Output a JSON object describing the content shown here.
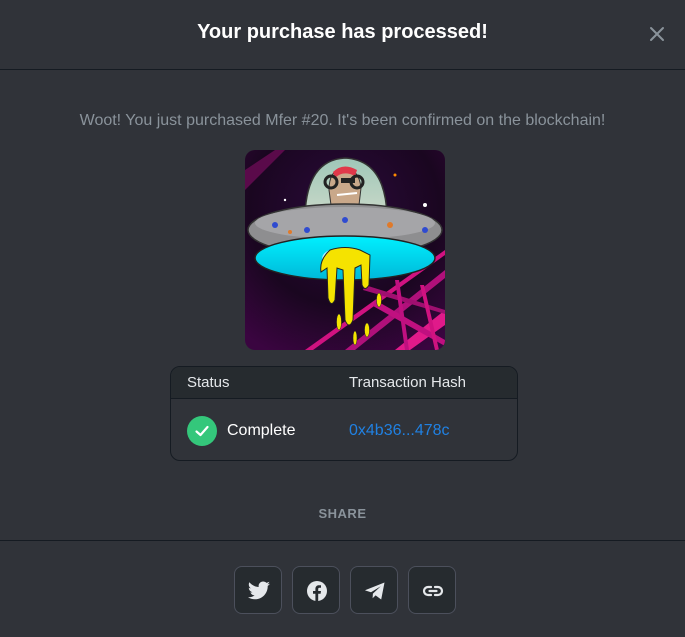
{
  "modal": {
    "title": "Your purchase has processed!",
    "message": "Woot! You just purchased Mfer #20. It's been confirmed on the blockchain!",
    "close_icon": "close-icon"
  },
  "table": {
    "headers": {
      "status": "Status",
      "hash": "Transaction Hash"
    },
    "row": {
      "status": "Complete",
      "hash": "0x4b36...478c"
    }
  },
  "share": {
    "label": "SHARE",
    "buttons": [
      "twitter-icon",
      "facebook-icon",
      "telegram-icon",
      "link-icon"
    ]
  },
  "colors": {
    "background": "#303339",
    "accent_link": "#2081e2",
    "success": "#34c77b"
  }
}
